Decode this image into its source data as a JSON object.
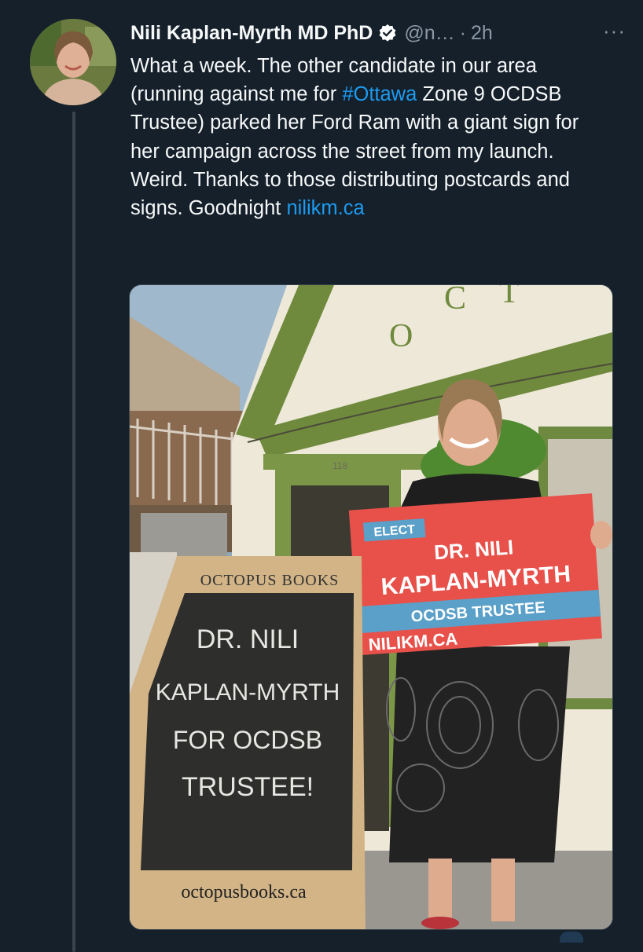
{
  "tweet": {
    "display_name": "Nili Kaplan-Myrth MD PhD",
    "handle": "@n…",
    "separator": "·",
    "timestamp": "2h",
    "more_label": "···",
    "text_pre": "What a week. The other candidate in our area (running against me for ",
    "hashtag": "#Ottawa",
    "text_mid": " Zone 9 OCDSB Trustee) parked her Ford Ram with a giant sign for her campaign across the street from my launch. Weird. Thanks to those distributing postcards and signs. Goodnight ",
    "link": "nilikm.ca"
  },
  "photo": {
    "store_letters": [
      "O",
      "C",
      "T"
    ],
    "address_number": "118",
    "sandwich_board_header": "OCTOPUS BOOKS",
    "chalk_line_1": "DR. NILI",
    "chalk_line_2": "KAPLAN-MYRTH",
    "chalk_line_3": "FOR OCDSB",
    "chalk_line_4": "TRUSTEE!",
    "sandwich_board_footer": "octopusbooks.ca",
    "sign_elect": "ELECT",
    "sign_name_1": "DR. NILI",
    "sign_name_2": "KAPLAN-MYRTH",
    "sign_role": "OCDSB TRUSTEE",
    "sign_url": "NILIKM.CA"
  },
  "colors": {
    "background": "#15202b",
    "link": "#1d9bf0",
    "verified_badge": "#ffffff",
    "sign_red": "#e8504a",
    "sign_blue": "#5aa0c8"
  },
  "icons": {
    "verified": "verified-badge-icon",
    "more": "more-horizontal-icon"
  }
}
